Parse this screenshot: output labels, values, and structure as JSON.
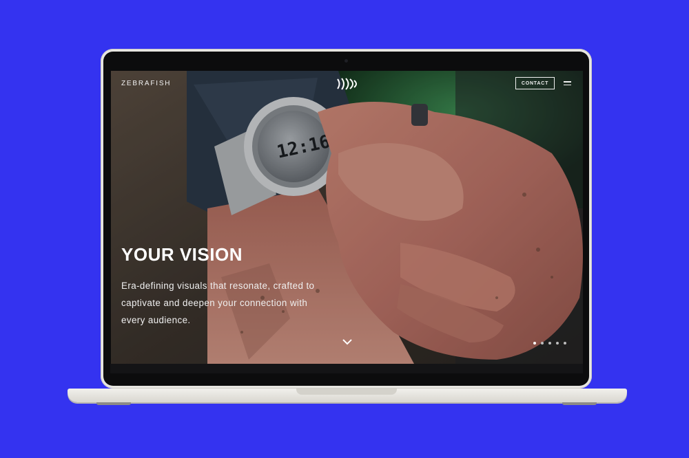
{
  "site": {
    "logo": "ZEBRAFISH",
    "contact_label": "CONTACT"
  },
  "hero": {
    "title": "YOUR VISION",
    "text": "Era-defining visuals that resonate, crafted to captivate and deepen your connection with every audience.",
    "watch_time": "12:16"
  },
  "slider": {
    "slide_count": 5,
    "active_index": 0
  },
  "icons": [
    "zebrafish-mark-icon",
    "hamburger-menu-icon",
    "chevron-down-icon"
  ],
  "colors": {
    "background": "#3433f0",
    "text": "#ffffff"
  }
}
